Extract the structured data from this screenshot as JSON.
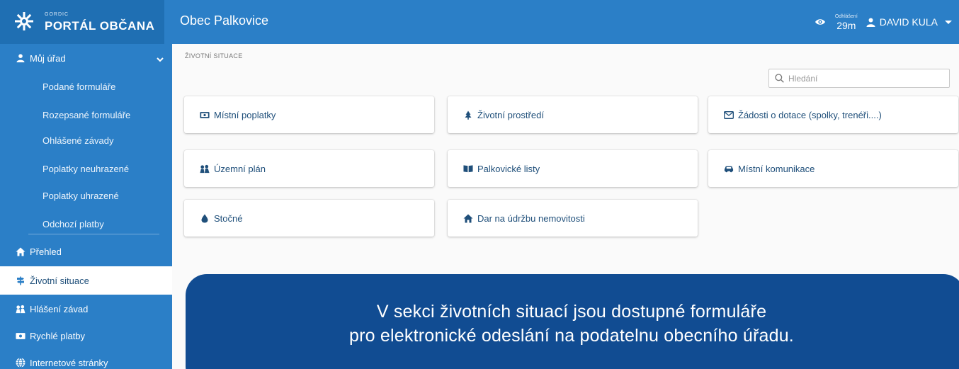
{
  "header": {
    "brand_small": "GORDIC",
    "brand_title": "PORTÁL OBČANA",
    "municipality": "Obec Palkovice",
    "logout_label": "Odhlášení",
    "logout_time": "29m",
    "user_name": "DAVID KULA"
  },
  "sidebar": {
    "group_label": "Můj úřad",
    "sub_items": [
      {
        "label": "Podané formuláře"
      },
      {
        "label": "Rozepsané formuláře"
      },
      {
        "label": "Ohlášené závady"
      },
      {
        "label": "Poplatky neuhrazené"
      },
      {
        "label": "Poplatky uhrazené"
      },
      {
        "label": "Odchozí platby"
      }
    ],
    "items": [
      {
        "label": "Přehled",
        "icon": "home-icon"
      },
      {
        "label": "Životní situace",
        "icon": "signpost-icon",
        "active": true
      },
      {
        "label": "Hlášení závad",
        "icon": "report-icon"
      },
      {
        "label": "Rychlé platby",
        "icon": "money-icon"
      },
      {
        "label": "Internetové stránky",
        "icon": "globe-icon"
      }
    ]
  },
  "main": {
    "breadcrumb": "ŽIVOTNÍ SITUACE",
    "search_placeholder": "Hledání",
    "cards": [
      {
        "label": "Místní poplatky",
        "icon": "money-icon"
      },
      {
        "label": "Životní prostředí",
        "icon": "tree-icon"
      },
      {
        "label": "Žádosti o dotace (spolky, trenéři....)",
        "icon": "envelope-icon"
      },
      {
        "label": "Územní plán",
        "icon": "map-icon"
      },
      {
        "label": "Palkovické listy",
        "icon": "book-icon"
      },
      {
        "label": "Místní komunikace",
        "icon": "car-icon"
      },
      {
        "label": "Stočné",
        "icon": "drop-icon"
      },
      {
        "label": "Dar na údržbu nemovitosti",
        "icon": "home-icon"
      }
    ]
  },
  "banner": {
    "line1": "V sekci životních situací jsou dostupné formuláře",
    "line2": "pro elektronické odeslání na podatelnu obecního úřadu."
  },
  "colors": {
    "primary": "#2b7fc7",
    "primary_dark": "#1f6fb3",
    "banner": "#114c92",
    "link_text": "#1f4f7a"
  }
}
